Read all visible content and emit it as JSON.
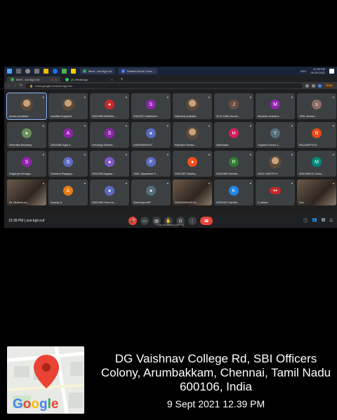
{
  "taskbar": {
    "apps": [
      {
        "label": "Meet - sce-bjyt-rcd",
        "color": "#34a853"
      },
      {
        "label": "Realtek Audio Cons...",
        "color": "#4285f4"
      }
    ],
    "clock_time": "12:39 PM",
    "clock_date": "09-09-2021",
    "lang": "ENG"
  },
  "browser": {
    "tabs": [
      {
        "label": "Meet - sce-bjyt-rcd",
        "color": "#34a853"
      },
      {
        "label": "(3) WhatsApp",
        "color": "#25d366"
      }
    ],
    "address": "meet.google.com/sce-bjyt-rcd",
    "profile_pill": "Error"
  },
  "participants": [
    {
      "name": "prince jonathan",
      "kind": "photo",
      "active": true
    },
    {
      "name": "Vanitha Gogineni",
      "kind": "photo"
    },
    {
      "name": "20D1990 BHARA...",
      "kind": "icon",
      "color": "#c62828"
    },
    {
      "name": "20D1971 Sakthivel",
      "kind": "letter",
      "letter": "S",
      "color": "#8e24aa"
    },
    {
      "name": "Hameed prakalki...",
      "kind": "photo"
    },
    {
      "name": "20 D 1981 Anush...",
      "kind": "letter",
      "letter": "J",
      "color": "#6d4c41"
    },
    {
      "name": "Monesh chandra...",
      "kind": "letter",
      "letter": "M",
      "color": "#8e24aa"
    },
    {
      "name": "1961 shivani",
      "kind": "letter",
      "letter": "s",
      "color": "#8d6e63"
    },
    {
      "name": "Reemika Mohanty",
      "kind": "icon",
      "color": "#6b8e5a"
    },
    {
      "name": "20D1984 Ajay K...",
      "kind": "letter",
      "letter": "A",
      "color": "#8e24aa"
    },
    {
      "name": "Shivangi Srikant...",
      "kind": "letter",
      "letter": "S",
      "color": "#8e24aa"
    },
    {
      "name": "AISHWARYA K",
      "kind": "icon",
      "color": "#5c6bc0"
    },
    {
      "name": "Ramesh Sricha...",
      "kind": "photo"
    },
    {
      "name": "Harshada",
      "kind": "letter",
      "letter": "H",
      "color": "#d81b60"
    },
    {
      "name": "Yogesh Kumar J...",
      "kind": "letter",
      "letter": "Y",
      "color": "#546e7a"
    },
    {
      "name": "RIA AARTHI A",
      "kind": "letter",
      "letter": "R",
      "color": "#e64a19"
    },
    {
      "name": "Suganya Venugo...",
      "kind": "letter",
      "letter": "S",
      "color": "#8e24aa"
    },
    {
      "name": "Sushma Rajagop...",
      "kind": "letter",
      "letter": "S",
      "color": "#5c6bc0"
    },
    {
      "name": "20D1964Jagaas...",
      "kind": "icon",
      "color": "#7e57c2"
    },
    {
      "name": "1961 Jayashree F...",
      "kind": "letter",
      "letter": "F",
      "color": "#5c6bc0"
    },
    {
      "name": "20D1967 Madhy...",
      "kind": "icon",
      "color": "#f4511e"
    },
    {
      "name": "20D1983 Raman...",
      "kind": "letter",
      "letter": "R",
      "color": "#2e7d32"
    },
    {
      "name": "2024 VINOTH K",
      "kind": "photo"
    },
    {
      "name": "20D1996 M. Kanc...",
      "kind": "letter",
      "letter": "M",
      "color": "#00897b"
    },
    {
      "name": "Dr. Muthukum...",
      "kind": "video"
    },
    {
      "name": "Anuraj. A",
      "kind": "letter",
      "letter": "A",
      "color": "#e67c13"
    },
    {
      "name": "20D1992 Siva ne...",
      "kind": "icon",
      "color": "#5c6bc0"
    },
    {
      "name": "Sreevidya MP",
      "kind": "icon",
      "color": "#546e7a"
    },
    {
      "name": "SIVASANKAR M...",
      "kind": "video"
    },
    {
      "name": "20D1907 Karthik...",
      "kind": "letter",
      "letter": "K",
      "color": "#1e88e5"
    },
    {
      "name": "3 others",
      "kind": "others"
    },
    {
      "name": "You",
      "kind": "video"
    }
  ],
  "meeting": {
    "time_code": "12:39 PM | sce-bjyt-rcd",
    "camera_tooltip": "Turn off camera (ctrl + e)"
  },
  "stamp": {
    "address": "DG Vaishnav College Rd, SBI Officers Colony, Arumbakkam, Chennai, Tamil Nadu 600106, India",
    "datetime": "9 Sept 2021 12.39 PM",
    "map_logo": "Google"
  }
}
